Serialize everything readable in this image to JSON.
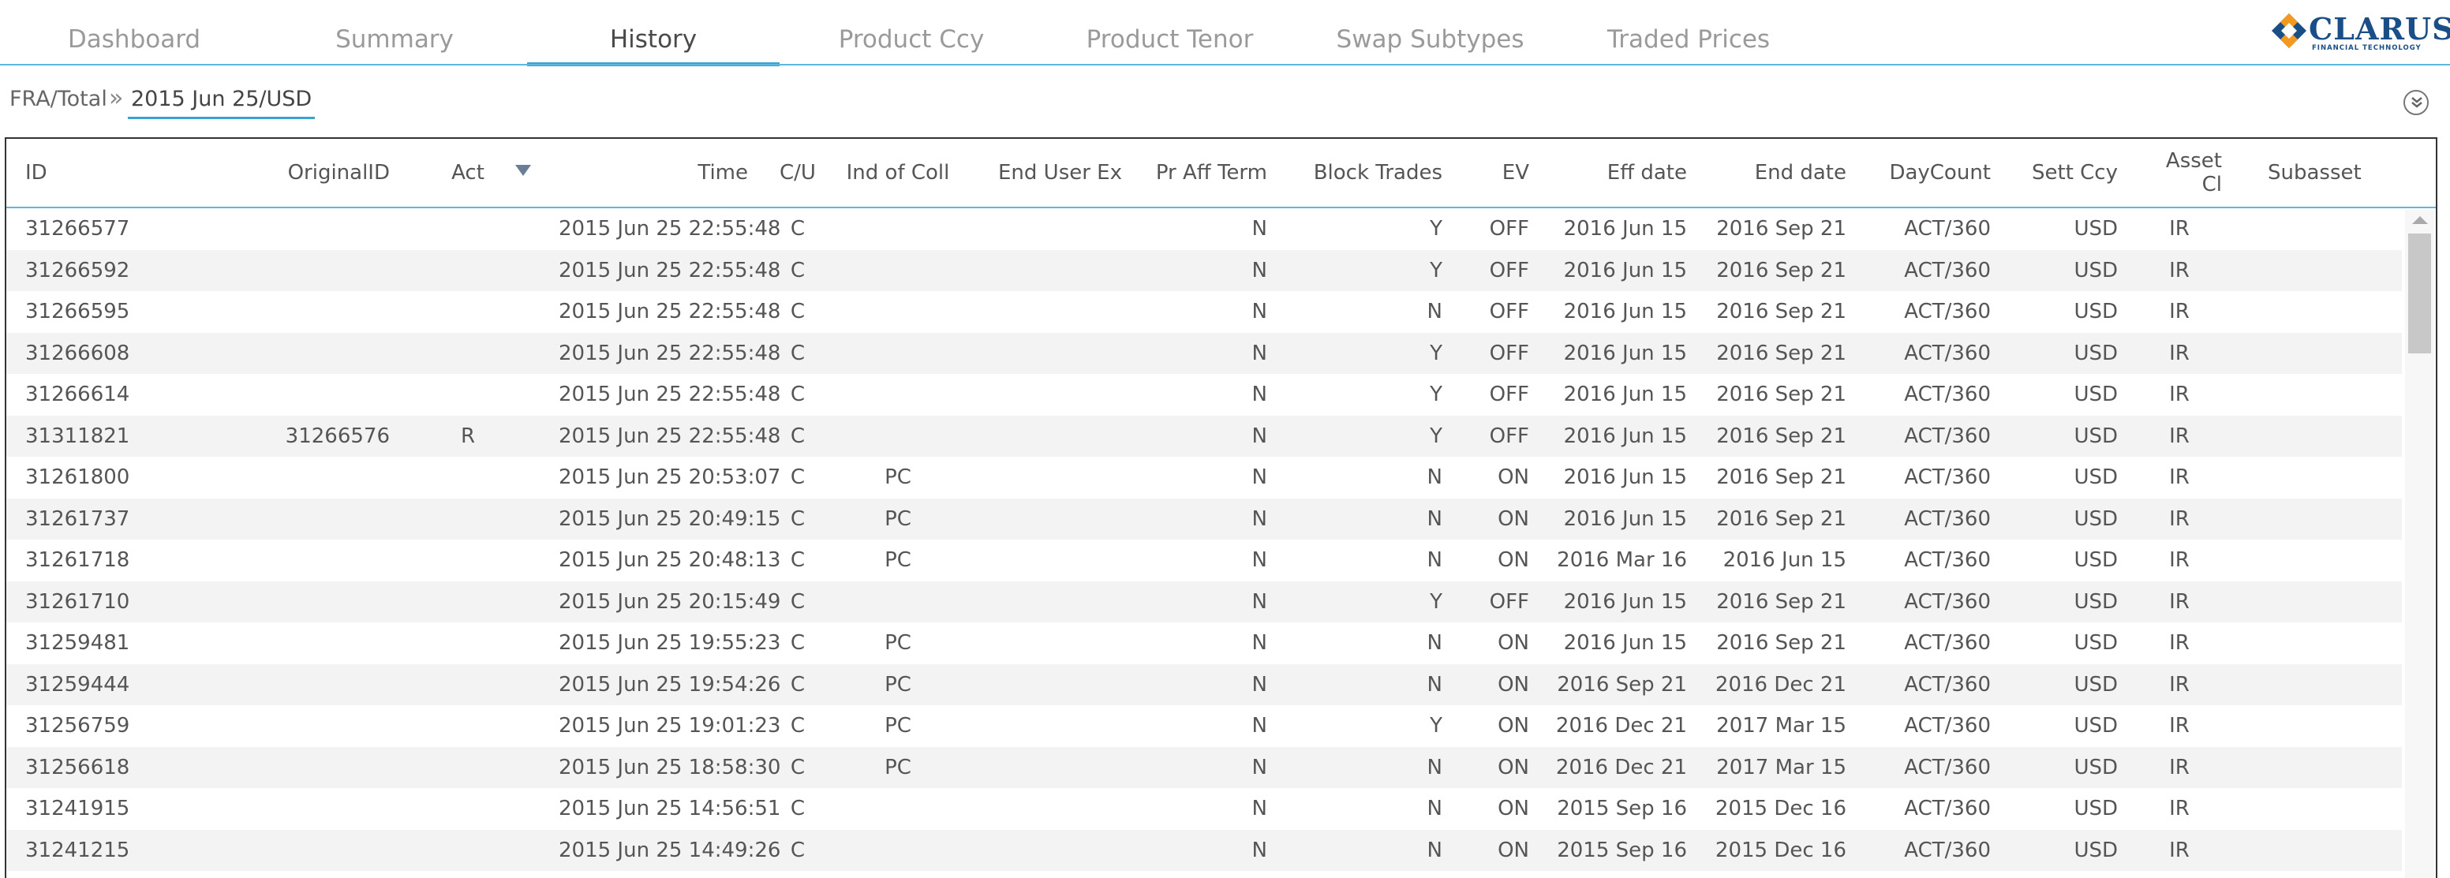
{
  "nav": {
    "tabs": [
      {
        "label": "Dashboard",
        "active": false
      },
      {
        "label": "Summary",
        "active": false
      },
      {
        "label": "History",
        "active": true
      },
      {
        "label": "Product Ccy",
        "active": false
      },
      {
        "label": "Product Tenor",
        "active": false
      },
      {
        "label": "Swap Subtypes",
        "active": false
      },
      {
        "label": "Traded Prices",
        "active": false
      }
    ],
    "logo": {
      "brand": "CLARUS",
      "tagline": "FINANCIAL TECHNOLOGY"
    }
  },
  "breadcrumb": {
    "items": [
      "FRA/Total",
      "2015 Jun 25/USD"
    ],
    "separator": "»"
  },
  "grid": {
    "sorted_column": "Act",
    "columns": [
      "ID",
      "OriginalID",
      "Act",
      "Time",
      "C/U",
      "Ind of Coll",
      "End User Ex",
      "Pr Aff Term",
      "Block Trades",
      "EV",
      "Eff date",
      "End date",
      "DayCount",
      "Sett Ccy",
      "Asset Cl",
      "Subasset"
    ],
    "header_labels": {
      "id": "ID",
      "original_id": "OriginalID",
      "act": "Act",
      "time": "Time",
      "cu": "C/U",
      "ind_coll": "Ind of Coll",
      "end_user_ex": "End User Ex",
      "pr_aff_term": "Pr Aff Term",
      "block_trades": "Block Trades",
      "ev": "EV",
      "eff_date": "Eff date",
      "end_date": "End date",
      "daycount": "DayCount",
      "sett_ccy": "Sett Ccy",
      "asset_cl_1": "Asset",
      "asset_cl_2": "Cl",
      "subasset": "Subasset"
    },
    "rows": [
      {
        "id": "31266577",
        "original_id": "",
        "act": "",
        "time": "2015 Jun 25 22:55:48",
        "cu": "C",
        "ind_coll": "",
        "end_user_ex": "",
        "pr_aff_term": "N",
        "block_trades": "Y",
        "ev": "OFF",
        "eff_date": "2016 Jun 15",
        "end_date": "2016 Sep 21",
        "daycount": "ACT/360",
        "sett_ccy": "USD",
        "asset_cl": "IR",
        "subasset": ""
      },
      {
        "id": "31266592",
        "original_id": "",
        "act": "",
        "time": "2015 Jun 25 22:55:48",
        "cu": "C",
        "ind_coll": "",
        "end_user_ex": "",
        "pr_aff_term": "N",
        "block_trades": "Y",
        "ev": "OFF",
        "eff_date": "2016 Jun 15",
        "end_date": "2016 Sep 21",
        "daycount": "ACT/360",
        "sett_ccy": "USD",
        "asset_cl": "IR",
        "subasset": ""
      },
      {
        "id": "31266595",
        "original_id": "",
        "act": "",
        "time": "2015 Jun 25 22:55:48",
        "cu": "C",
        "ind_coll": "",
        "end_user_ex": "",
        "pr_aff_term": "N",
        "block_trades": "N",
        "ev": "OFF",
        "eff_date": "2016 Jun 15",
        "end_date": "2016 Sep 21",
        "daycount": "ACT/360",
        "sett_ccy": "USD",
        "asset_cl": "IR",
        "subasset": ""
      },
      {
        "id": "31266608",
        "original_id": "",
        "act": "",
        "time": "2015 Jun 25 22:55:48",
        "cu": "C",
        "ind_coll": "",
        "end_user_ex": "",
        "pr_aff_term": "N",
        "block_trades": "Y",
        "ev": "OFF",
        "eff_date": "2016 Jun 15",
        "end_date": "2016 Sep 21",
        "daycount": "ACT/360",
        "sett_ccy": "USD",
        "asset_cl": "IR",
        "subasset": ""
      },
      {
        "id": "31266614",
        "original_id": "",
        "act": "",
        "time": "2015 Jun 25 22:55:48",
        "cu": "C",
        "ind_coll": "",
        "end_user_ex": "",
        "pr_aff_term": "N",
        "block_trades": "Y",
        "ev": "OFF",
        "eff_date": "2016 Jun 15",
        "end_date": "2016 Sep 21",
        "daycount": "ACT/360",
        "sett_ccy": "USD",
        "asset_cl": "IR",
        "subasset": ""
      },
      {
        "id": "31311821",
        "original_id": "31266576",
        "act": "R",
        "time": "2015 Jun 25 22:55:48",
        "cu": "C",
        "ind_coll": "",
        "end_user_ex": "",
        "pr_aff_term": "N",
        "block_trades": "Y",
        "ev": "OFF",
        "eff_date": "2016 Jun 15",
        "end_date": "2016 Sep 21",
        "daycount": "ACT/360",
        "sett_ccy": "USD",
        "asset_cl": "IR",
        "subasset": ""
      },
      {
        "id": "31261800",
        "original_id": "",
        "act": "",
        "time": "2015 Jun 25 20:53:07",
        "cu": "C",
        "ind_coll": "PC",
        "end_user_ex": "",
        "pr_aff_term": "N",
        "block_trades": "N",
        "ev": "ON",
        "eff_date": "2016 Jun 15",
        "end_date": "2016 Sep 21",
        "daycount": "ACT/360",
        "sett_ccy": "USD",
        "asset_cl": "IR",
        "subasset": ""
      },
      {
        "id": "31261737",
        "original_id": "",
        "act": "",
        "time": "2015 Jun 25 20:49:15",
        "cu": "C",
        "ind_coll": "PC",
        "end_user_ex": "",
        "pr_aff_term": "N",
        "block_trades": "N",
        "ev": "ON",
        "eff_date": "2016 Jun 15",
        "end_date": "2016 Sep 21",
        "daycount": "ACT/360",
        "sett_ccy": "USD",
        "asset_cl": "IR",
        "subasset": ""
      },
      {
        "id": "31261718",
        "original_id": "",
        "act": "",
        "time": "2015 Jun 25 20:48:13",
        "cu": "C",
        "ind_coll": "PC",
        "end_user_ex": "",
        "pr_aff_term": "N",
        "block_trades": "N",
        "ev": "ON",
        "eff_date": "2016 Mar 16",
        "end_date": "2016 Jun 15",
        "daycount": "ACT/360",
        "sett_ccy": "USD",
        "asset_cl": "IR",
        "subasset": ""
      },
      {
        "id": "31261710",
        "original_id": "",
        "act": "",
        "time": "2015 Jun 25 20:15:49",
        "cu": "C",
        "ind_coll": "",
        "end_user_ex": "",
        "pr_aff_term": "N",
        "block_trades": "Y",
        "ev": "OFF",
        "eff_date": "2016 Jun 15",
        "end_date": "2016 Sep 21",
        "daycount": "ACT/360",
        "sett_ccy": "USD",
        "asset_cl": "IR",
        "subasset": ""
      },
      {
        "id": "31259481",
        "original_id": "",
        "act": "",
        "time": "2015 Jun 25 19:55:23",
        "cu": "C",
        "ind_coll": "PC",
        "end_user_ex": "",
        "pr_aff_term": "N",
        "block_trades": "N",
        "ev": "ON",
        "eff_date": "2016 Jun 15",
        "end_date": "2016 Sep 21",
        "daycount": "ACT/360",
        "sett_ccy": "USD",
        "asset_cl": "IR",
        "subasset": ""
      },
      {
        "id": "31259444",
        "original_id": "",
        "act": "",
        "time": "2015 Jun 25 19:54:26",
        "cu": "C",
        "ind_coll": "PC",
        "end_user_ex": "",
        "pr_aff_term": "N",
        "block_trades": "N",
        "ev": "ON",
        "eff_date": "2016 Sep 21",
        "end_date": "2016 Dec 21",
        "daycount": "ACT/360",
        "sett_ccy": "USD",
        "asset_cl": "IR",
        "subasset": ""
      },
      {
        "id": "31256759",
        "original_id": "",
        "act": "",
        "time": "2015 Jun 25 19:01:23",
        "cu": "C",
        "ind_coll": "PC",
        "end_user_ex": "",
        "pr_aff_term": "N",
        "block_trades": "Y",
        "ev": "ON",
        "eff_date": "2016 Dec 21",
        "end_date": "2017 Mar 15",
        "daycount": "ACT/360",
        "sett_ccy": "USD",
        "asset_cl": "IR",
        "subasset": ""
      },
      {
        "id": "31256618",
        "original_id": "",
        "act": "",
        "time": "2015 Jun 25 18:58:30",
        "cu": "C",
        "ind_coll": "PC",
        "end_user_ex": "",
        "pr_aff_term": "N",
        "block_trades": "N",
        "ev": "ON",
        "eff_date": "2016 Dec 21",
        "end_date": "2017 Mar 15",
        "daycount": "ACT/360",
        "sett_ccy": "USD",
        "asset_cl": "IR",
        "subasset": ""
      },
      {
        "id": "31241915",
        "original_id": "",
        "act": "",
        "time": "2015 Jun 25 14:56:51",
        "cu": "C",
        "ind_coll": "",
        "end_user_ex": "",
        "pr_aff_term": "N",
        "block_trades": "N",
        "ev": "ON",
        "eff_date": "2015 Sep 16",
        "end_date": "2015 Dec 16",
        "daycount": "ACT/360",
        "sett_ccy": "USD",
        "asset_cl": "IR",
        "subasset": ""
      },
      {
        "id": "31241215",
        "original_id": "",
        "act": "",
        "time": "2015 Jun 25 14:49:26",
        "cu": "C",
        "ind_coll": "",
        "end_user_ex": "",
        "pr_aff_term": "N",
        "block_trades": "N",
        "ev": "ON",
        "eff_date": "2015 Sep 16",
        "end_date": "2015 Dec 16",
        "daycount": "ACT/360",
        "sett_ccy": "USD",
        "asset_cl": "IR",
        "subasset": ""
      }
    ]
  },
  "colors": {
    "accent": "#3aa3d1",
    "row_alt": "#f3f3f3",
    "logo_blue": "#1a4e86",
    "logo_orange": "#f39a1e"
  }
}
